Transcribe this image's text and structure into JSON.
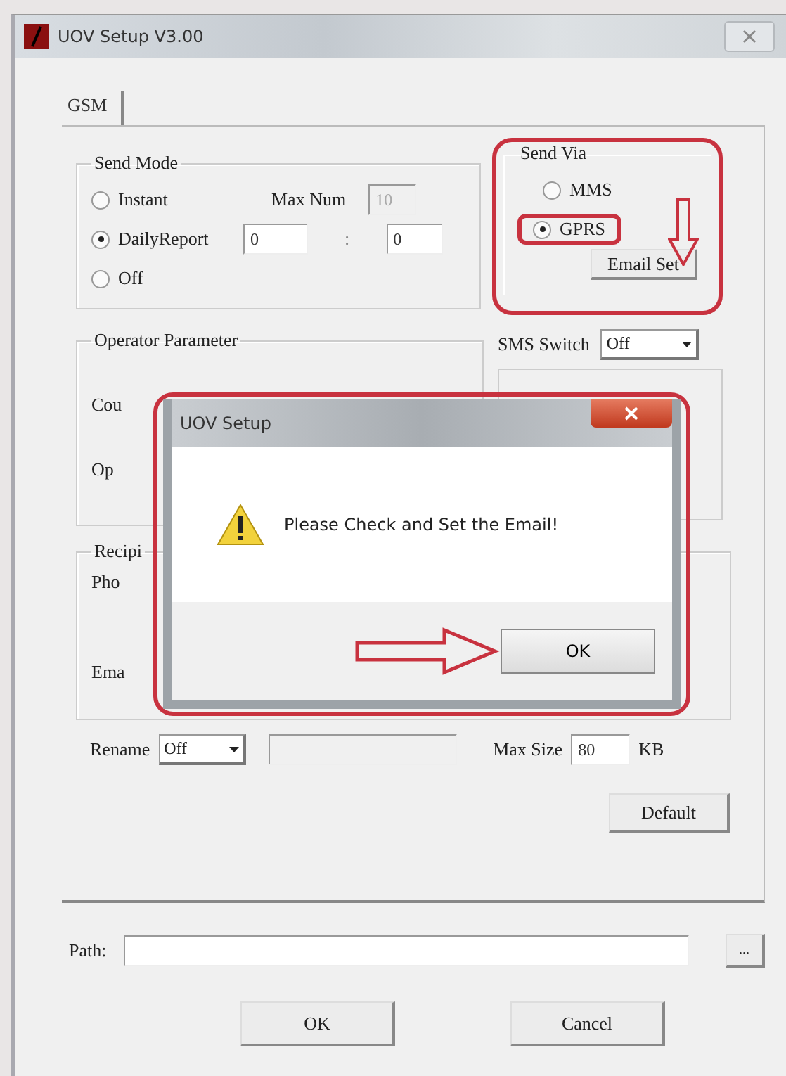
{
  "window": {
    "title": "UOV Setup V3.00"
  },
  "tabs": [
    {
      "label": "GSM",
      "selected": true
    }
  ],
  "send_mode": {
    "title": "Send Mode",
    "options": [
      {
        "label": "Instant",
        "selected": false
      },
      {
        "label": "DailyReport",
        "selected": true
      },
      {
        "label": "Off",
        "selected": false
      }
    ],
    "max_num_label": "Max Num",
    "max_num": {
      "value": "10",
      "disabled": true
    },
    "daily_hour": "0",
    "separator": ":",
    "daily_minute": "0"
  },
  "send_via": {
    "title": "Send Via",
    "options": [
      {
        "label": "MMS",
        "selected": false
      },
      {
        "label": "GPRS",
        "selected": true
      }
    ],
    "button": "Email Set"
  },
  "operator_parameter": {
    "title": "Operator Parameter",
    "labels": [
      "Cou",
      "Op"
    ]
  },
  "sms_switch": {
    "label": "SMS Switch",
    "value": "Off"
  },
  "recipient": {
    "title": "Recipi",
    "labels": [
      "Pho",
      "Ema"
    ]
  },
  "rename": {
    "label": "Rename",
    "value": "Off"
  },
  "max_size": {
    "label": "Max Size",
    "value": "80",
    "unit": "KB"
  },
  "default_button": "Default",
  "path": {
    "label": "Path:",
    "browse": "..."
  },
  "buttons": [
    "OK",
    "Cancel"
  ],
  "message_box": {
    "title": "UOV Setup",
    "message": "Please Check and Set the Email!",
    "button": "OK"
  }
}
